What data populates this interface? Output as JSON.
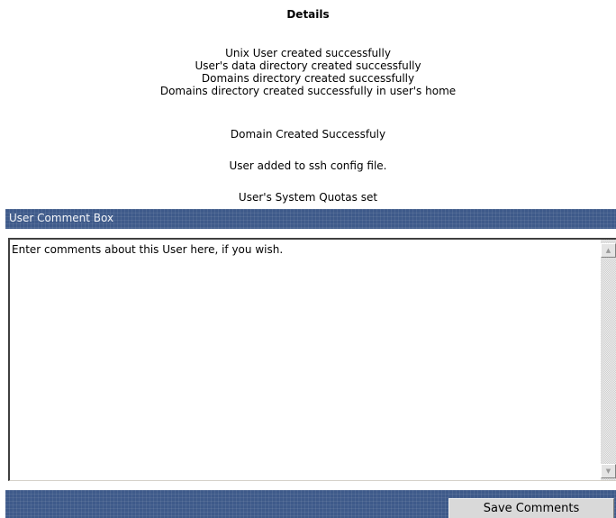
{
  "details": {
    "title": "Details",
    "messages_group1": [
      "Unix User created successfully",
      "User's data directory created successfully",
      "Domains directory created successfully",
      "Domains directory created successfully in user's home"
    ],
    "domain_message": "Domain Created Successfuly",
    "ssh_message": "User added to ssh config file.",
    "quota_message": "User's System Quotas set"
  },
  "comment_box": {
    "title": "User Comment Box",
    "text": "Enter comments about this User here, if you wish.",
    "scrollbar": {
      "up_icon": "▲",
      "down_icon": "▼"
    }
  },
  "footer": {
    "save_label": "Save Comments"
  },
  "colors": {
    "bar": "#3e5a8a",
    "bar_text": "#f2f4f8"
  }
}
